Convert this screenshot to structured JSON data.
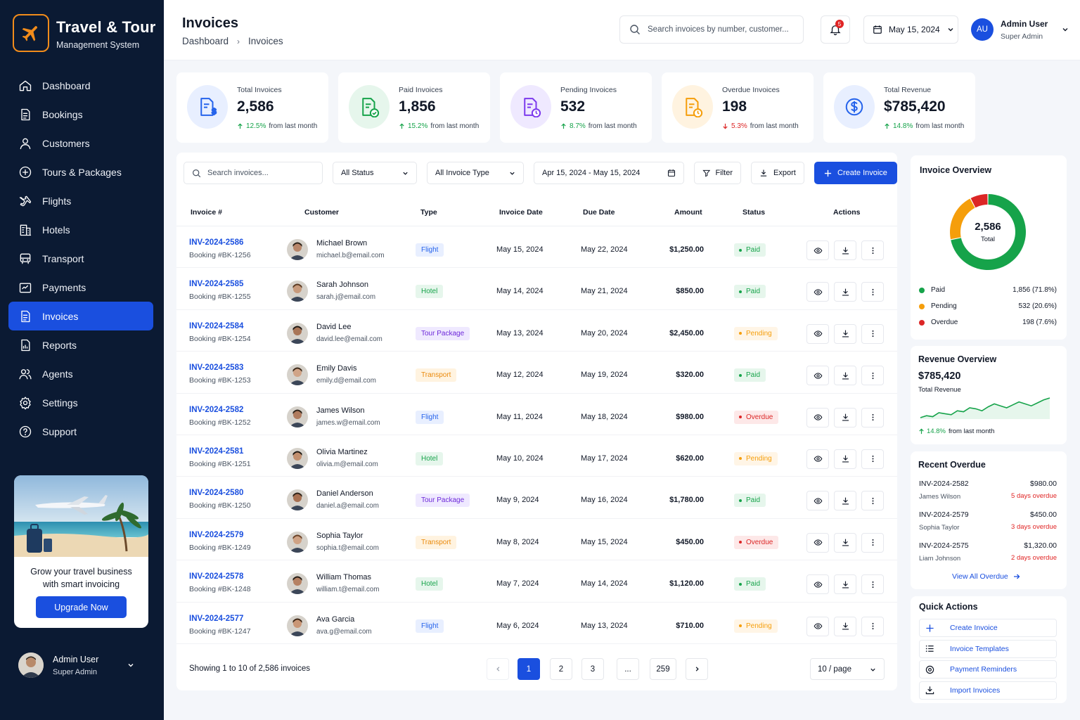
{
  "brand": {
    "title": "Travel & Tour",
    "subtitle": "Management System"
  },
  "nav": [
    {
      "label": "Dashboard",
      "icon": "home-icon"
    },
    {
      "label": "Bookings",
      "icon": "document-icon"
    },
    {
      "label": "Customers",
      "icon": "user-icon"
    },
    {
      "label": "Tours & Packages",
      "icon": "plus-circle-icon"
    },
    {
      "label": "Flights",
      "icon": "plane-icon"
    },
    {
      "label": "Hotels",
      "icon": "building-icon"
    },
    {
      "label": "Transport",
      "icon": "bus-icon"
    },
    {
      "label": "Payments",
      "icon": "wallet-icon"
    },
    {
      "label": "Invoices",
      "icon": "invoice-icon",
      "active": true
    },
    {
      "label": "Reports",
      "icon": "report-icon"
    },
    {
      "label": "Agents",
      "icon": "agents-icon"
    },
    {
      "label": "Settings",
      "icon": "gear-icon"
    },
    {
      "label": "Support",
      "icon": "help-icon"
    }
  ],
  "promo": {
    "line1": "Grow your travel business",
    "line2": "with smart invoicing",
    "button": "Upgrade Now"
  },
  "sidebar_user": {
    "name": "Admin User",
    "role": "Super Admin"
  },
  "header": {
    "title": "Invoices",
    "breadcrumb": [
      "Dashboard",
      "Invoices"
    ],
    "search_placeholder": "Search invoices by number, customer...",
    "notifications": "5",
    "date": "May 15, 2024",
    "user_initials": "AU",
    "user_name": "Admin User",
    "user_role": "Super Admin"
  },
  "stats": [
    {
      "label": "Total Invoices",
      "value": "2,586",
      "change": "12.5%",
      "suffix": "from last month",
      "trend": "up",
      "color": "#2563eb",
      "bg": "#e8efff"
    },
    {
      "label": "Paid Invoices",
      "value": "1,856",
      "change": "15.2%",
      "suffix": "from last month",
      "trend": "up",
      "color": "#16a34a",
      "bg": "#e6f6ec"
    },
    {
      "label": "Pending Invoices",
      "value": "532",
      "change": "8.7%",
      "suffix": "from last month",
      "trend": "up",
      "color": "#7c3aed",
      "bg": "#efe9ff"
    },
    {
      "label": "Overdue Invoices",
      "value": "198",
      "change": "5.3%",
      "suffix": "from last month",
      "trend": "down",
      "color": "#f59e0b",
      "bg": "#fff3e0"
    },
    {
      "label": "Total Revenue",
      "value": "$785,420",
      "change": "14.8%",
      "suffix": "from last month",
      "trend": "up",
      "color": "#2563eb",
      "bg": "#e8efff"
    }
  ],
  "toolbar": {
    "search_placeholder": "Search invoices...",
    "status": "All Status",
    "type": "All Invoice Type",
    "date_range": "Apr 15, 2024 - May 15, 2024",
    "filter": "Filter",
    "export": "Export",
    "create": "Create Invoice"
  },
  "table": {
    "columns": [
      "Invoice #",
      "Customer",
      "Type",
      "Invoice Date",
      "Due Date",
      "Amount",
      "Status",
      "Actions"
    ],
    "rows": [
      {
        "invoice": "INV-2024-2586",
        "booking": "Booking #BK-1256",
        "name": "Michael Brown",
        "email": "michael.b@email.com",
        "type": "Flight",
        "invoice_date": "May 15, 2024",
        "due_date": "May 22, 2024",
        "amount": "$1,250.00",
        "status": "Paid"
      },
      {
        "invoice": "INV-2024-2585",
        "booking": "Booking #BK-1255",
        "name": "Sarah Johnson",
        "email": "sarah.j@email.com",
        "type": "Hotel",
        "invoice_date": "May 14, 2024",
        "due_date": "May 21, 2024",
        "amount": "$850.00",
        "status": "Paid"
      },
      {
        "invoice": "INV-2024-2584",
        "booking": "Booking #BK-1254",
        "name": "David Lee",
        "email": "david.lee@email.com",
        "type": "Tour Package",
        "invoice_date": "May 13, 2024",
        "due_date": "May 20, 2024",
        "amount": "$2,450.00",
        "status": "Pending"
      },
      {
        "invoice": "INV-2024-2583",
        "booking": "Booking #BK-1253",
        "name": "Emily Davis",
        "email": "emily.d@email.com",
        "type": "Transport",
        "invoice_date": "May 12, 2024",
        "due_date": "May 19, 2024",
        "amount": "$320.00",
        "status": "Paid"
      },
      {
        "invoice": "INV-2024-2582",
        "booking": "Booking #BK-1252",
        "name": "James Wilson",
        "email": "james.w@email.com",
        "type": "Flight",
        "invoice_date": "May 11, 2024",
        "due_date": "May 18, 2024",
        "amount": "$980.00",
        "status": "Overdue"
      },
      {
        "invoice": "INV-2024-2581",
        "booking": "Booking #BK-1251",
        "name": "Olivia Martinez",
        "email": "olivia.m@email.com",
        "type": "Hotel",
        "invoice_date": "May 10, 2024",
        "due_date": "May 17, 2024",
        "amount": "$620.00",
        "status": "Pending"
      },
      {
        "invoice": "INV-2024-2580",
        "booking": "Booking #BK-1250",
        "name": "Daniel Anderson",
        "email": "daniel.a@email.com",
        "type": "Tour Package",
        "invoice_date": "May 9, 2024",
        "due_date": "May 16, 2024",
        "amount": "$1,780.00",
        "status": "Paid"
      },
      {
        "invoice": "INV-2024-2579",
        "booking": "Booking #BK-1249",
        "name": "Sophia Taylor",
        "email": "sophia.t@email.com",
        "type": "Transport",
        "invoice_date": "May 8, 2024",
        "due_date": "May 15, 2024",
        "amount": "$450.00",
        "status": "Overdue"
      },
      {
        "invoice": "INV-2024-2578",
        "booking": "Booking #BK-1248",
        "name": "William Thomas",
        "email": "william.t@email.com",
        "type": "Hotel",
        "invoice_date": "May 7, 2024",
        "due_date": "May 14, 2024",
        "amount": "$1,120.00",
        "status": "Paid"
      },
      {
        "invoice": "INV-2024-2577",
        "booking": "Booking #BK-1247",
        "name": "Ava Garcia",
        "email": "ava.g@email.com",
        "type": "Flight",
        "invoice_date": "May 6, 2024",
        "due_date": "May 13, 2024",
        "amount": "$710.00",
        "status": "Pending"
      }
    ]
  },
  "pagination": {
    "showing": "Showing 1 to 10 of 2,586 invoices",
    "pages": [
      "1",
      "2",
      "3",
      "...",
      "259"
    ],
    "current": "1",
    "per_page": "10 / page"
  },
  "overview": {
    "title": "Invoice Overview",
    "center_value": "2,586",
    "center_label": "Total",
    "segments": [
      {
        "label": "Paid",
        "value": 1856,
        "display": "1,856 (71.8%)",
        "color": "#16a34a"
      },
      {
        "label": "Pending",
        "value": 532,
        "display": "532 (20.6%)",
        "color": "#f59e0b"
      },
      {
        "label": "Overdue",
        "value": 198,
        "display": "198 (7.6%)",
        "color": "#dc2626"
      }
    ]
  },
  "revenue": {
    "title": "Revenue Overview",
    "value": "$785,420",
    "label": "Total Revenue",
    "change": "14.8%",
    "suffix": "from last month",
    "sparkline": [
      12,
      14,
      13,
      17,
      16,
      15,
      19,
      18,
      22,
      21,
      19,
      23,
      26,
      24,
      22,
      25,
      28,
      26,
      24,
      27,
      30,
      32
    ]
  },
  "recent_overdue": {
    "title": "Recent Overdue",
    "items": [
      {
        "invoice": "INV-2024-2582",
        "amount": "$980.00",
        "name": "James Wilson",
        "days": "5 days overdue"
      },
      {
        "invoice": "INV-2024-2579",
        "amount": "$450.00",
        "name": "Sophia Taylor",
        "days": "3 days overdue"
      },
      {
        "invoice": "INV-2024-2575",
        "amount": "$1,320.00",
        "name": "Liam Johnson",
        "days": "2 days overdue"
      }
    ],
    "view_all": "View All Overdue"
  },
  "quick_actions": {
    "title": "Quick Actions",
    "items": [
      {
        "label": "Create Invoice",
        "icon": "plus-icon"
      },
      {
        "label": "Invoice Templates",
        "icon": "list-icon"
      },
      {
        "label": "Payment Reminders",
        "icon": "reminder-icon"
      },
      {
        "label": "Import Invoices",
        "icon": "import-icon"
      }
    ]
  },
  "colors": {
    "accent": "#1a4fdf",
    "sidebar": "#0b1a33",
    "brand_orange": "#f28c1b"
  }
}
